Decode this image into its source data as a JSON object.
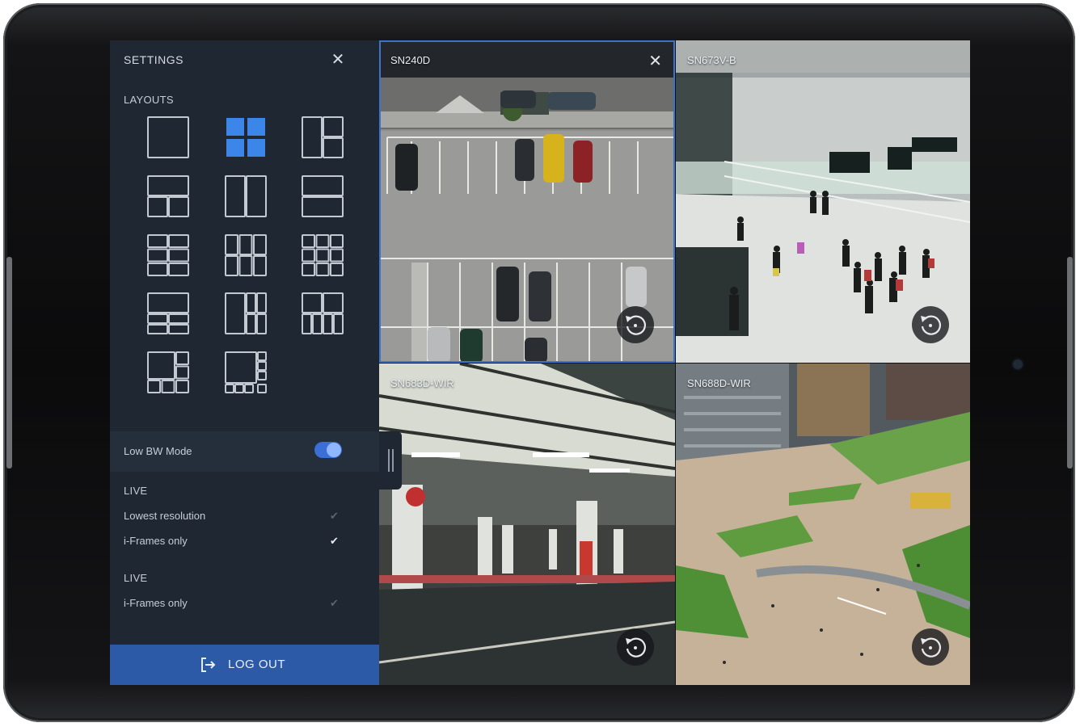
{
  "settings": {
    "title": "SETTINGS",
    "layouts_label": "LAYOUTS",
    "layouts": [
      {
        "name": "single",
        "selected": false
      },
      {
        "name": "grid-2x2",
        "selected": true
      },
      {
        "name": "large-left-two-right",
        "selected": false
      },
      {
        "name": "top-wide-two-bottom",
        "selected": false
      },
      {
        "name": "two-columns",
        "selected": false
      },
      {
        "name": "two-rows",
        "selected": false
      },
      {
        "name": "grid-2x3",
        "selected": false
      },
      {
        "name": "grid-3x3",
        "selected": false
      },
      {
        "name": "grid-3x3-dense",
        "selected": false
      },
      {
        "name": "top-wide-four-bottom",
        "selected": false
      },
      {
        "name": "large-left-four-right",
        "selected": false
      },
      {
        "name": "top-two-bottom-four",
        "selected": false
      },
      {
        "name": "large-topleft-mixed",
        "selected": false
      },
      {
        "name": "large-topleft-strip",
        "selected": false
      }
    ],
    "low_bw_mode": {
      "label": "Low BW Mode",
      "enabled": true
    },
    "live_section_1": {
      "heading": "LIVE",
      "options": [
        {
          "label": "Lowest resolution",
          "checked": false
        },
        {
          "label": "i-Frames only",
          "checked": true
        }
      ]
    },
    "live_section_2": {
      "heading": "LIVE",
      "options": [
        {
          "label": "i-Frames only",
          "checked": false
        }
      ]
    },
    "logout_label": "LOG OUT"
  },
  "cameras": [
    {
      "id": "SN240D",
      "scene": "parking-lot-aerial",
      "selected": true
    },
    {
      "id": "SN673V-B",
      "scene": "airport-terminal"
    },
    {
      "id": "SN683D-WIR",
      "scene": "parking-garage"
    },
    {
      "id": "SN688D-WIR",
      "scene": "city-plaza"
    }
  ],
  "colors": {
    "panel_bg": "#1f2733",
    "accent": "#3b86e8",
    "logout_bg": "#2d5aa6",
    "selected_border": "#3d74c9"
  }
}
